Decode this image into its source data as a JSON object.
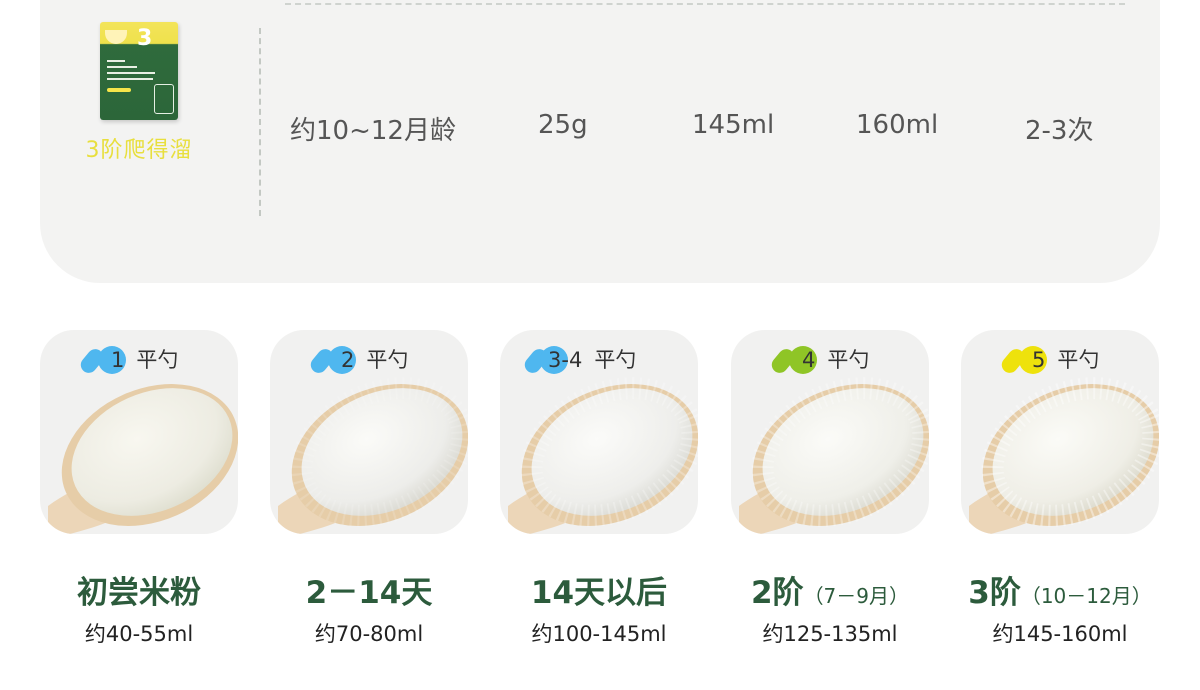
{
  "summary": {
    "stage_label": "3阶爬得溜",
    "age": "约10~12月龄",
    "powder": "25g",
    "water": "145ml",
    "total": "160ml",
    "times": "2-3次"
  },
  "colors": {
    "title_green": "#2c5b3c",
    "stage_yellow": "#e8df3e",
    "blue": "#4fb7ef",
    "green": "#8fc526",
    "yellow": "#eee20c"
  },
  "stages": [
    {
      "num": "1",
      "unit": "平勺",
      "title": "初尝米粉",
      "sub": "",
      "amount": "约40-55ml",
      "accent": "#4fb7ef"
    },
    {
      "num": "2",
      "unit": "平勺",
      "title": "2－14天",
      "sub": "",
      "amount": "约70-80ml",
      "accent": "#4fb7ef"
    },
    {
      "num": "3-4",
      "unit": "平勺",
      "title": "14天以后",
      "sub": "",
      "amount": "约100-145ml",
      "accent": "#4fb7ef"
    },
    {
      "num": "4",
      "unit": "平勺",
      "title": "2阶",
      "sub": "（7－9月）",
      "amount": "约125-135ml",
      "accent": "#8fc526"
    },
    {
      "num": "5",
      "unit": "平勺",
      "title": "3阶",
      "sub": "（10－12月）",
      "amount": "约145-160ml",
      "accent": "#eee20c"
    }
  ]
}
